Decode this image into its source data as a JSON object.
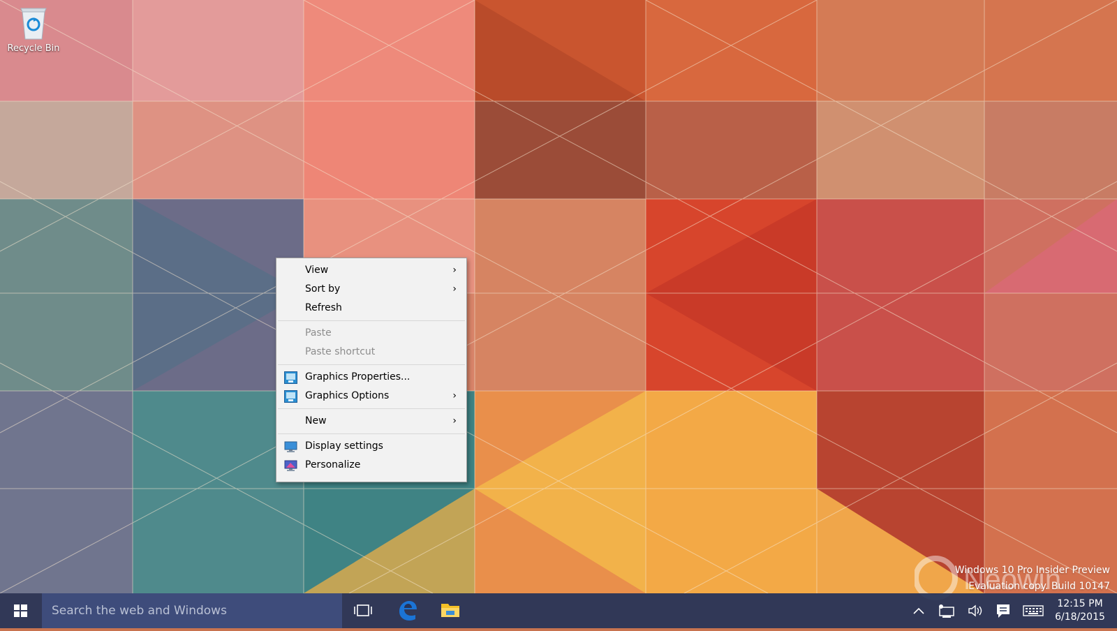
{
  "desktop": {
    "icons": [
      {
        "label": "Recycle Bin",
        "icon": "recycle-bin-icon"
      }
    ]
  },
  "context_menu": {
    "items": [
      {
        "label": "View",
        "submenu": true,
        "disabled": false
      },
      {
        "label": "Sort by",
        "submenu": true,
        "disabled": false
      },
      {
        "label": "Refresh",
        "submenu": false,
        "disabled": false
      },
      {
        "label": "Paste",
        "submenu": false,
        "disabled": true
      },
      {
        "label": "Paste shortcut",
        "submenu": false,
        "disabled": true
      },
      {
        "label": "Graphics Properties...",
        "submenu": false,
        "disabled": false,
        "icon": "intel-graphics-icon"
      },
      {
        "label": "Graphics Options",
        "submenu": true,
        "disabled": false,
        "icon": "intel-graphics-icon"
      },
      {
        "label": "New",
        "submenu": true,
        "disabled": false
      },
      {
        "label": "Display settings",
        "submenu": false,
        "disabled": false,
        "icon": "display-icon"
      },
      {
        "label": "Personalize",
        "submenu": false,
        "disabled": false,
        "icon": "personalize-icon"
      }
    ],
    "arrow_glyph": "›"
  },
  "taskbar": {
    "search_placeholder": "Search the web and Windows",
    "pinned": [
      "task-view-icon",
      "edge-icon",
      "file-explorer-icon"
    ],
    "tray_icons": [
      "chevron-up-icon",
      "network-icon",
      "volume-icon",
      "action-center-icon",
      "keyboard-icon"
    ],
    "time": "12:15 PM",
    "date": "6/18/2015"
  },
  "watermark": {
    "line1": "Windows 10 Pro Insider Preview",
    "line2": "Evaluation copy. Build 10147",
    "brand": "Neowin"
  },
  "colors": {
    "taskbar_bg": "#263458",
    "search_bg": "#3e4c7b",
    "menu_bg": "#f2f2f2",
    "edge_blue": "#1b74d6",
    "folder_yellow": "#f4c026"
  }
}
